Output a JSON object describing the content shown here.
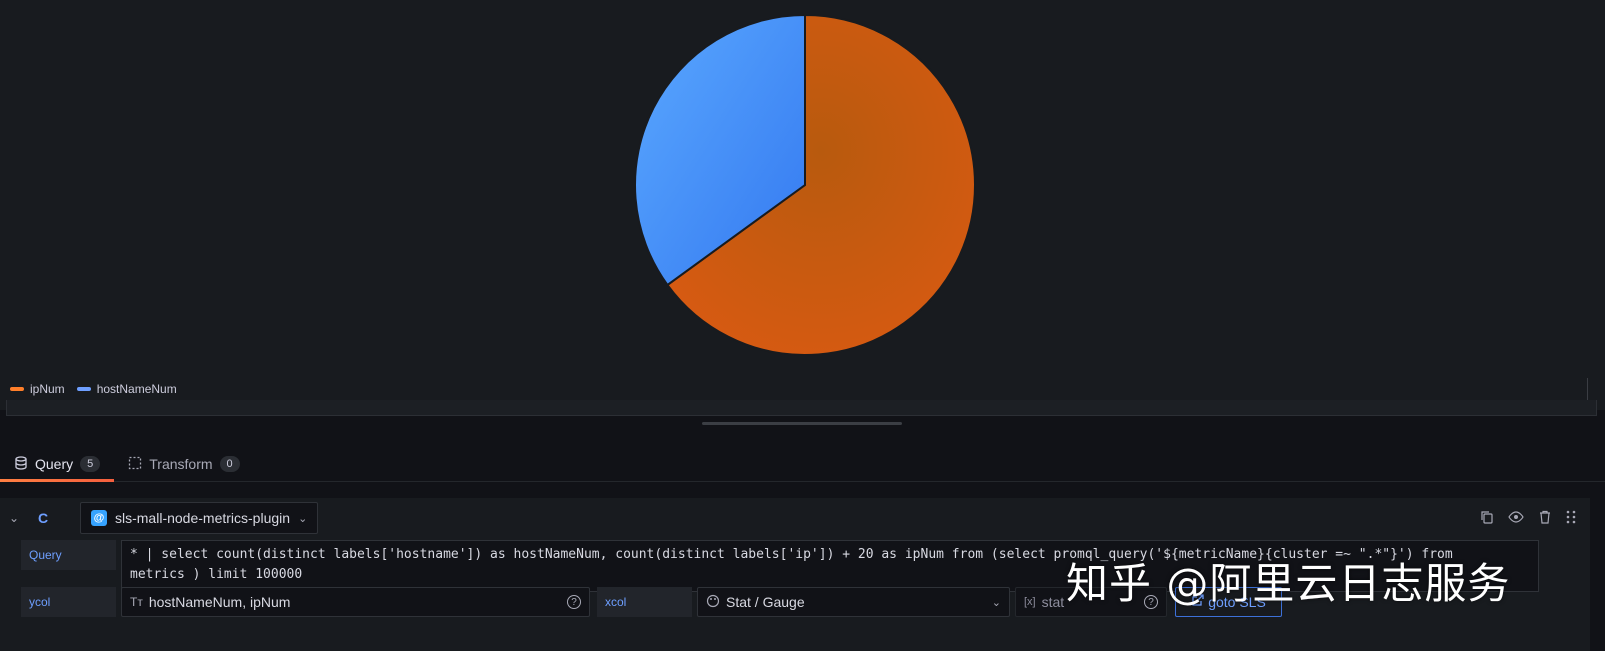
{
  "chart_data": {
    "type": "pie",
    "slices": [
      {
        "label": "ipNum",
        "value": 65,
        "color": "#e0640f"
      },
      {
        "label": "hostNameNum",
        "value": 35,
        "color": "#4a90ff"
      }
    ],
    "legend": [
      "ipNum",
      "hostNameNum"
    ],
    "legend_placement": "bottom-left"
  },
  "tabs": [
    {
      "label": "Query",
      "count": "5"
    },
    {
      "label": "Transform",
      "count": "0"
    }
  ],
  "query": {
    "ref_id": "C",
    "datasource": "sls-mall-node-metrics-plugin",
    "query_label": "Query",
    "query_text_line1": "* | select count(distinct labels['hostname']) as hostNameNum, count(distinct labels['ip']) + 20 as ipNum from (select promql_query('${metricName}{cluster =~ \".*\"}') from",
    "query_text_line2": "metrics ) limit 100000",
    "ycol_label": "ycol",
    "ycol_value": "hostNameNum, ipNum",
    "xcol_label": "xcol",
    "xcol_value": "Stat / Gauge",
    "stat_placeholder": "stat",
    "goto_label": "goto SLS"
  },
  "watermark": "知乎 @阿里云日志服务"
}
